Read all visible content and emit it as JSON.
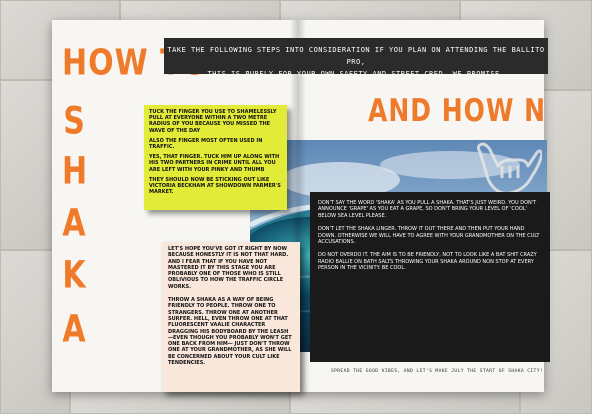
{
  "left_page": {
    "heading": "HOW TO",
    "vertical_letters": [
      "S",
      "H",
      "A",
      "K",
      "A"
    ],
    "yellow_box": [
      "TUCK THE FINGER YOU USE TO SHAMELESSLY PULL AT EVERYONE WITHIN A TWO METRE RADIUS OF YOU BECAUSE YOU MISSED THE WAVE OF THE DAY",
      "ALSO THE FINGER MOST OFTEN USED IN TRAFFIC.",
      "YES, THAT FINGER. TUCK HIM UP ALONG WITH HIS TWO PARTNERS IN CRIME UNTIL ALL YOU ARE LEFT WITH YOUR PINKY AND THUMB",
      "THEY SHOULD NOW BE STICKING OUT LIKE VICTORIA BECKHAM AT SHOWDOWN FARMER'S MARKET."
    ],
    "peach_box": [
      "LET'S HOPE YOU'VE GOT IT RIGHT BY NOW BECAUSE HONESTLY IT IS NOT THAT HARD. AND I FEAR THAT IF YOU HAVE NOT MASTERED IT BY THIS STAGE YOU ARE PROBABLY ONE OF THOSE WHO IS STILL OBLIVIOUS TO HOW THE TRAFFIC CIRCLE WORKS.",
      "THROW A SHAKA AS A WAY OF BEING FRIENDLY TO PEOPLE. THROW ONE TO STRANGERS. THROW ONE AT ANOTHER SURFER. HELL, EVEN THROW ONE AT THAT FLUORESCENT VAALIE CHARACTER DRAGGING HIS BODYBOARD BY THE LEASH —EVEN THOUGH YOU PROBABLY WON'T GET ONE BACK FROM HIM— JUST DON'T THROW ONE AT YOUR GRANDMOTHER, AS SHE WILL BE CONCERNED ABOUT YOUR CULT LIKE TENDENCIES."
    ]
  },
  "banner": {
    "line1": "TAKE THE FOLLOWING STEPS INTO CONSIDERATION IF YOU PLAN ON ATTENDING THE BALLITO PRO,",
    "line2": "THIS IS PURELY FOR YOUR OWN SAFETY AND STREET CRED, WE PROMISE."
  },
  "right_page": {
    "heading": "AND HOW NOT TO",
    "dark_box": [
      "DON'T SAY THE WORD 'SHAKA' AS YOU PULL A SHAKA. THAT'S JUST WEIRD. YOU DON'T ANNOUNCE 'GRAPE' AS YOU EAT A GRAPE, SO DON'T BRING YOUR LEVEL OF 'COOL' BELOW SEA LEVEL PLEASE.",
      "DON'T LET THE SHAKA LINGER. THROW IT OUT THERE AND THEN PUT YOUR HAND DOWN. OTHERWISE WE WILL HAVE TO AGREE WITH YOUR GRANDMOTHER ON THE CULT ACCUSATIONS.",
      "DO NOT OVERDO IT. THE AIM IS TO BE FRIENDLY, NOT TO LOOK LIKE A BAT SHIT CRAZY RADIO BALLIE ON BATH SALTS THROWING YOUR SHAKA AROUND NON STOP AT EVERY PERSON IN THE VICINITY. BE COOL."
    ],
    "footer": "SPREAD THE GOOD VIBES, AND LET'S MAKE JULY THE START OF SHAKA CITY!"
  },
  "colors": {
    "accent_orange": "#ef7a2a",
    "yellow_box": "#e2ec38",
    "peach_box": "#f9e7dc",
    "dark_box": "#1a1a1a"
  },
  "icons": [
    "shaka-hand-icon"
  ]
}
